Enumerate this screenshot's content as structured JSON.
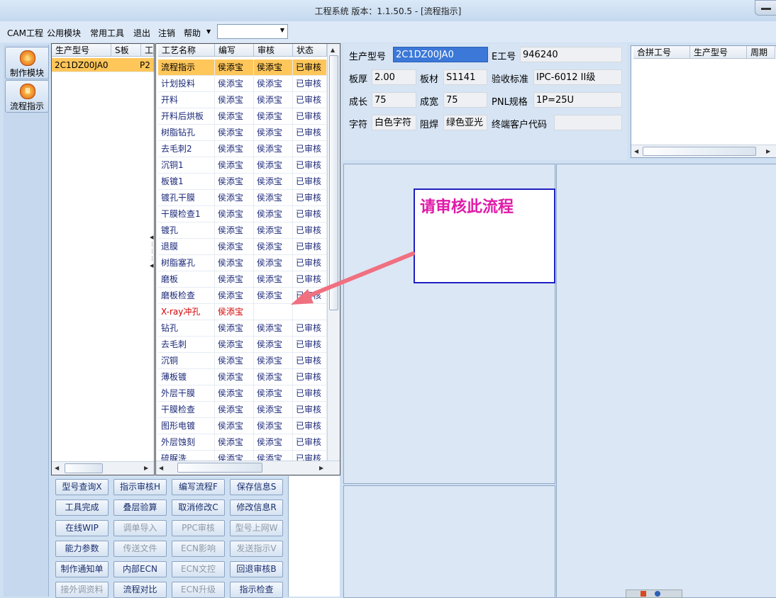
{
  "window": {
    "title": "工程系统   版本：1.1.50.5 - [流程指示]"
  },
  "menu": {
    "items": [
      "CAM工程",
      "公用模块",
      "常用工具",
      "退出",
      "注销",
      "帮助"
    ],
    "combo_value": ""
  },
  "launcher": {
    "items": [
      "制作模块",
      "流程指示"
    ]
  },
  "part_grid": {
    "headers": [
      "生产型号",
      "S板",
      "工"
    ],
    "rows": [
      {
        "model": "2C1DZ00JA0",
        "s": "P2",
        "extra": ""
      }
    ]
  },
  "process_grid": {
    "headers": [
      "工艺名称",
      "编写",
      "审核",
      "状态"
    ],
    "rows": [
      [
        "流程指示",
        "侯添宝",
        "侯添宝",
        "已审核"
      ],
      [
        "计划投料",
        "侯添宝",
        "侯添宝",
        "已审核"
      ],
      [
        "开料",
        "侯添宝",
        "侯添宝",
        "已审核"
      ],
      [
        "开料后烘板",
        "侯添宝",
        "侯添宝",
        "已审核"
      ],
      [
        "树脂钻孔",
        "侯添宝",
        "侯添宝",
        "已审核"
      ],
      [
        "去毛刺2",
        "侯添宝",
        "侯添宝",
        "已审核"
      ],
      [
        "沉铜1",
        "侯添宝",
        "侯添宝",
        "已审核"
      ],
      [
        "板镀1",
        "侯添宝",
        "侯添宝",
        "已审核"
      ],
      [
        "镀孔干膜",
        "侯添宝",
        "侯添宝",
        "已审核"
      ],
      [
        "干膜检查1",
        "侯添宝",
        "侯添宝",
        "已审核"
      ],
      [
        "镀孔",
        "侯添宝",
        "侯添宝",
        "已审核"
      ],
      [
        "退膜",
        "侯添宝",
        "侯添宝",
        "已审核"
      ],
      [
        "树脂塞孔",
        "侯添宝",
        "侯添宝",
        "已审核"
      ],
      [
        "磨板",
        "侯添宝",
        "侯添宝",
        "已审核"
      ],
      [
        "磨板检查",
        "侯添宝",
        "侯添宝",
        "已审核"
      ],
      [
        "X-ray冲孔",
        "侯添宝",
        "",
        ""
      ],
      [
        "钻孔",
        "侯添宝",
        "侯添宝",
        "已审核"
      ],
      [
        "去毛刺",
        "侯添宝",
        "侯添宝",
        "已审核"
      ],
      [
        "沉铜",
        "侯添宝",
        "侯添宝",
        "已审核"
      ],
      [
        "薄板镀",
        "侯添宝",
        "侯添宝",
        "已审核"
      ],
      [
        "外层干膜",
        "侯添宝",
        "侯添宝",
        "已审核"
      ],
      [
        "干膜检查",
        "侯添宝",
        "侯添宝",
        "已审核"
      ],
      [
        "图形电镀",
        "侯添宝",
        "侯添宝",
        "已审核"
      ],
      [
        "外层蚀刻",
        "侯添宝",
        "侯添宝",
        "已审核"
      ],
      [
        "硫脲洗",
        "侯添宝",
        "侯添宝",
        "已审核"
      ]
    ],
    "selected_row": 0,
    "pending_row": 15
  },
  "info": {
    "model_label": "生产型号",
    "model_value": "2C1DZ00JA0",
    "eno_label": "E工号",
    "eno_value": "946240",
    "thickness_label": "板厚",
    "thickness_value": "2.00",
    "material_label": "板材",
    "material_value": "S1141",
    "standard_label": "验收标准",
    "standard_value": "IPC-6012 II级",
    "length_label": "成长",
    "length_value": "75",
    "width_label": "成宽",
    "width_value": "75",
    "pnl_label": "PNL规格",
    "pnl_value": "1P=25U",
    "char_label": "字符",
    "char_value": "白色字符",
    "mask_label": "阻焊",
    "mask_value": "绿色亚光",
    "customer_label": "终端客户代码",
    "customer_value": ""
  },
  "merge_grid": {
    "headers": [
      "合拼工号",
      "生产型号",
      "周期"
    ]
  },
  "callout": {
    "text": "请审核此流程",
    "color": "#e01aa8"
  },
  "buttons": [
    {
      "label": "型号查询X",
      "enabled": true
    },
    {
      "label": "指示审核H",
      "enabled": true
    },
    {
      "label": "编写流程F",
      "enabled": true
    },
    {
      "label": "保存信息S",
      "enabled": true
    },
    {
      "label": "工具完成",
      "enabled": true
    },
    {
      "label": "叠层验算",
      "enabled": true
    },
    {
      "label": "取消修改C",
      "enabled": true
    },
    {
      "label": "修改信息R",
      "enabled": true
    },
    {
      "label": "在线WIP",
      "enabled": true
    },
    {
      "label": "调单导入",
      "enabled": false
    },
    {
      "label": "PPC审核",
      "enabled": false
    },
    {
      "label": "型号上网W",
      "enabled": false
    },
    {
      "label": "能力参数",
      "enabled": true
    },
    {
      "label": "传送文件",
      "enabled": false
    },
    {
      "label": "ECN影响",
      "enabled": false
    },
    {
      "label": "发送指示V",
      "enabled": false
    },
    {
      "label": "制作通知单",
      "enabled": true
    },
    {
      "label": "内部ECN",
      "enabled": true
    },
    {
      "label": "ECN文控",
      "enabled": false
    },
    {
      "label": "回退审核B",
      "enabled": true
    },
    {
      "label": "接外调资料",
      "enabled": false
    },
    {
      "label": "流程对比",
      "enabled": true
    },
    {
      "label": "ECN升级",
      "enabled": false
    },
    {
      "label": "指示检查",
      "enabled": true
    }
  ],
  "colors": {
    "accent": "#e01aa8",
    "selection": "#ffc65a",
    "arrow": "#f07080",
    "callout_border": "#2020c0"
  }
}
